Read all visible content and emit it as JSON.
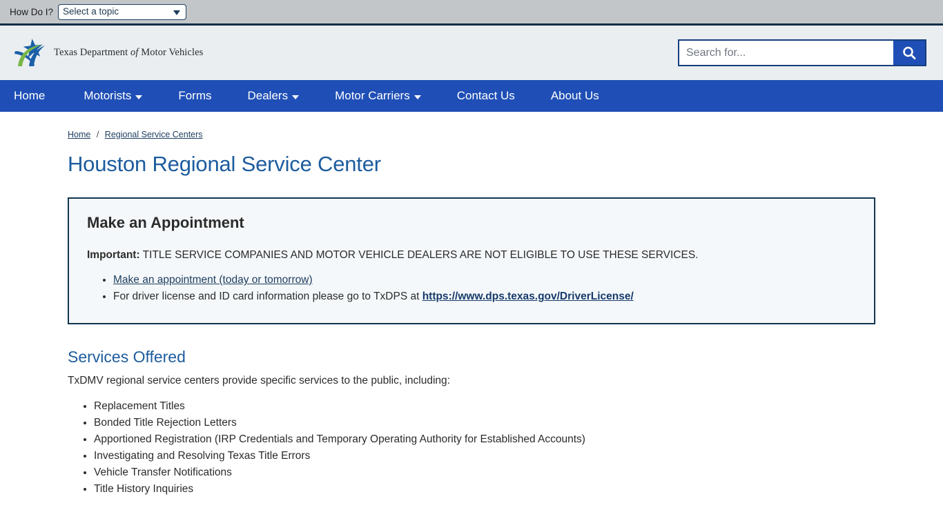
{
  "topbar": {
    "label": "How Do I?",
    "select_value": "Select a topic",
    "caret_icon": "chevron-down-icon"
  },
  "header": {
    "logo_icon": "txdmv-star-logo",
    "brand_pre": "Texas Department ",
    "brand_italic": "of",
    "brand_post": " Motor Vehicles",
    "search_placeholder": "Search for...",
    "search_value": "",
    "search_icon": "search-icon"
  },
  "nav": {
    "items": [
      {
        "label": "Home",
        "has_dropdown": false
      },
      {
        "label": "Motorists",
        "has_dropdown": true
      },
      {
        "label": "Forms",
        "has_dropdown": false
      },
      {
        "label": "Dealers",
        "has_dropdown": true
      },
      {
        "label": "Motor Carriers",
        "has_dropdown": true
      },
      {
        "label": "Contact Us",
        "has_dropdown": false
      },
      {
        "label": "About Us",
        "has_dropdown": false
      }
    ]
  },
  "breadcrumb": {
    "home": "Home",
    "separator": "/",
    "current": "Regional Service Centers"
  },
  "page": {
    "title": "Houston Regional Service Center"
  },
  "callout": {
    "title": "Make an Appointment",
    "important_label": "Important:",
    "important_text": " TITLE SERVICE COMPANIES AND MOTOR VEHICLE DEALERS ARE NOT ELIGIBLE TO USE THESE SERVICES.",
    "item1_link": "Make an appointment (today or tomorrow)",
    "item2_text": "For driver license and ID card information please go to TxDPS at ",
    "item2_link": "https://www.dps.texas.gov/DriverLicense/"
  },
  "services": {
    "title": "Services Offered",
    "intro": "TxDMV regional service centers provide specific services to the public, including:",
    "items": [
      "Replacement Titles",
      "Bonded Title Rejection Letters",
      "Apportioned Registration (IRP Credentials and Temporary Operating Authority for Established Accounts)",
      "Investigating and Resolving Texas Title Errors",
      "Vehicle Transfer Notifications",
      "Title History Inquiries"
    ]
  },
  "colors": {
    "nav_blue": "#1f4fb6",
    "topbar_gray": "#c3c6c9",
    "masthead_gray": "#eaeef1",
    "title_blue": "#1d5c9e",
    "border_navy": "#11354f",
    "callout_bg": "#f5f8fa",
    "logo_green": "#7ab648",
    "logo_blue": "#1b5fa8"
  }
}
